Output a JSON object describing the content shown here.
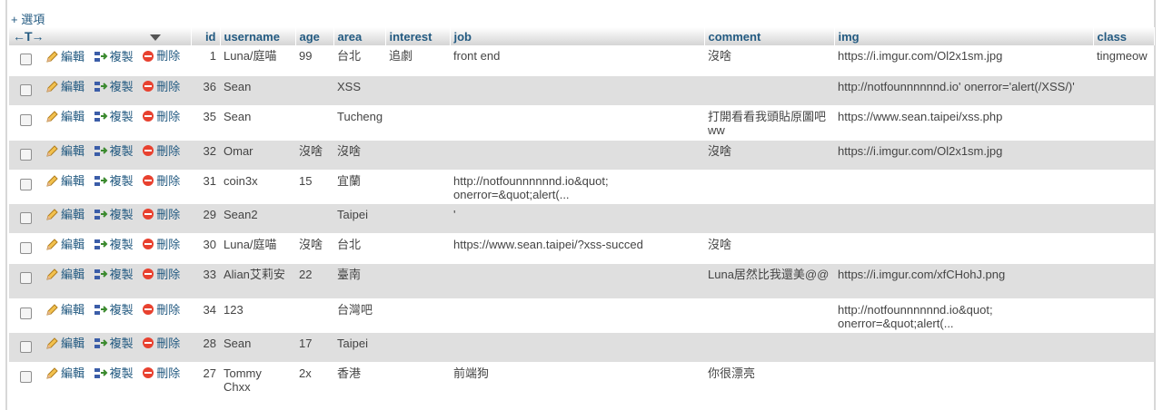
{
  "options_label": "+ 選項",
  "arrows_label": "←T→",
  "actions": {
    "edit": "編輯",
    "copy": "複製",
    "delete": "刪除"
  },
  "columns": [
    "id",
    "username",
    "age",
    "area",
    "interest",
    "job",
    "comment",
    "img",
    "class"
  ],
  "rows": [
    {
      "id": "1",
      "username": "Luna/庭喵",
      "age": "99",
      "area": "台北",
      "interest": "追劇",
      "job": "front end",
      "comment": "沒啥",
      "img": "https://i.imgur.com/Ol2x1sm.jpg",
      "class": "tingmeow"
    },
    {
      "id": "36",
      "username": "Sean",
      "age": "",
      "area": "XSS",
      "interest": "",
      "job": "",
      "comment": "",
      "img": "http://notfounnnnnnd.io' onerror='alert(/XSS/)'",
      "class": ""
    },
    {
      "id": "35",
      "username": "Sean",
      "age": "",
      "area": "Tucheng",
      "interest": "",
      "job": "",
      "comment": "打開看看我頭貼原圖吧ww",
      "img": "https://www.sean.taipei/xss.php",
      "class": ""
    },
    {
      "id": "32",
      "username": "Omar",
      "age": "沒啥",
      "area": "沒啥",
      "interest": "",
      "job": "",
      "comment": "沒啥",
      "img": "https://i.imgur.com/Ol2x1sm.jpg",
      "class": ""
    },
    {
      "id": "31",
      "username": "coin3x",
      "age": "15",
      "area": "宜蘭",
      "interest": "",
      "job": "http://notfounnnnnnd.io&quot; onerror=&quot;alert(...",
      "comment": "",
      "img": "",
      "class": ""
    },
    {
      "id": "29",
      "username": "Sean2",
      "age": "",
      "area": "Taipei",
      "interest": "",
      "job": "'",
      "comment": "",
      "img": "",
      "class": ""
    },
    {
      "id": "30",
      "username": "Luna/庭喵",
      "age": "沒啥",
      "area": "台北",
      "interest": "",
      "job": "https://www.sean.taipei/?xss-succed",
      "comment": "沒啥",
      "img": "",
      "class": ""
    },
    {
      "id": "33",
      "username": "Alian艾莉安",
      "age": "22",
      "area": "臺南",
      "interest": "",
      "job": "",
      "comment": "Luna居然比我還美@@",
      "img": "https://i.imgur.com/xfCHohJ.png",
      "class": ""
    },
    {
      "id": "34",
      "username": "123",
      "age": "",
      "area": "台灣吧",
      "interest": "",
      "job": "",
      "comment": "",
      "img": "http://notfounnnnnnd.io&quot; onerror=&quot;alert(...",
      "class": ""
    },
    {
      "id": "28",
      "username": "Sean",
      "age": "17",
      "area": "Taipei",
      "interest": "",
      "job": "",
      "comment": "",
      "img": "",
      "class": ""
    },
    {
      "id": "27",
      "username": "Tommy Chxx",
      "age": "2x",
      "area": "香港",
      "interest": "",
      "job": "前端狗",
      "comment": "你很漂亮",
      "img": "",
      "class": ""
    }
  ]
}
